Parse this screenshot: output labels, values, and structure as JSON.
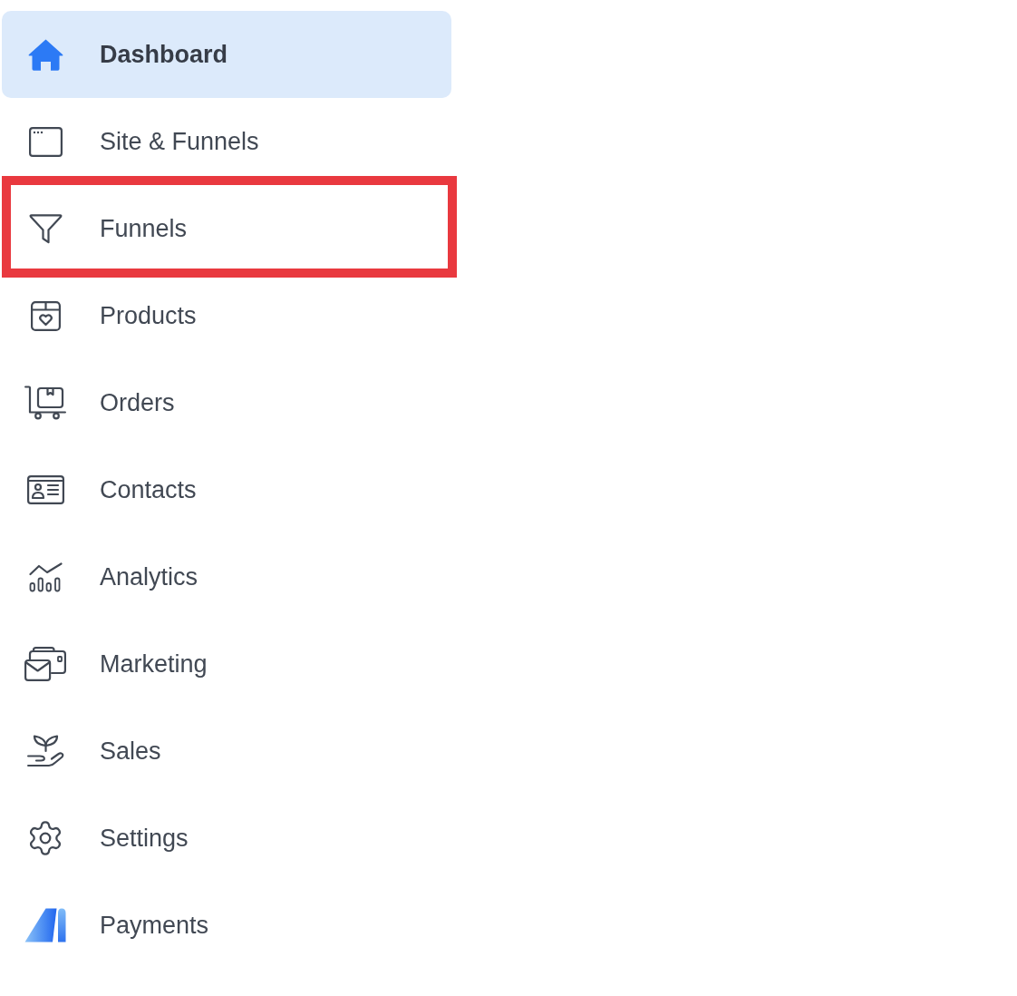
{
  "sidebar": {
    "items": [
      {
        "label": "Dashboard",
        "selected": true,
        "highlighted": false
      },
      {
        "label": "Site & Funnels",
        "selected": false,
        "highlighted": false
      },
      {
        "label": "Funnels",
        "selected": false,
        "highlighted": true
      },
      {
        "label": "Products",
        "selected": false,
        "highlighted": false
      },
      {
        "label": "Orders",
        "selected": false,
        "highlighted": false
      },
      {
        "label": "Contacts",
        "selected": false,
        "highlighted": false
      },
      {
        "label": "Analytics",
        "selected": false,
        "highlighted": false
      },
      {
        "label": "Marketing",
        "selected": false,
        "highlighted": false
      },
      {
        "label": "Sales",
        "selected": false,
        "highlighted": false
      },
      {
        "label": "Settings",
        "selected": false,
        "highlighted": false
      },
      {
        "label": "Payments",
        "selected": false,
        "highlighted": false
      }
    ]
  }
}
